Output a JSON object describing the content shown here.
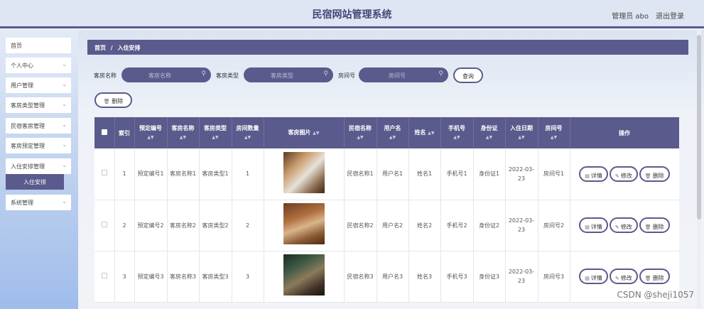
{
  "header": {
    "title": "民宿网站管理系统",
    "user_label": "管理员 abo",
    "logout_label": "退出登录"
  },
  "sidebar": {
    "items": [
      {
        "label": "首页",
        "has_children": false
      },
      {
        "label": "个人中心",
        "has_children": true
      },
      {
        "label": "用户管理",
        "has_children": true
      },
      {
        "label": "客房类型管理",
        "has_children": true
      },
      {
        "label": "民宿客房管理",
        "has_children": true
      },
      {
        "label": "客房预定管理",
        "has_children": true
      },
      {
        "label": "入住安排管理",
        "has_children": true
      },
      {
        "label": "系统管理",
        "has_children": true
      }
    ],
    "active_sub": "入住安排"
  },
  "breadcrumb": {
    "home": "首页",
    "separator": "/",
    "current": "入住安排"
  },
  "search": {
    "fields": [
      {
        "label": "客房名称",
        "placeholder": "客房名称"
      },
      {
        "label": "客房类型",
        "placeholder": "客房类型"
      },
      {
        "label": "房间号",
        "placeholder": "房间号"
      }
    ],
    "button_label": "查询"
  },
  "toolbar": {
    "delete_label": "删除"
  },
  "table": {
    "columns": [
      "索引",
      "预定编号",
      "客房名称",
      "客房类型",
      "房间数量",
      "客房图片",
      "民宿名称",
      "用户名",
      "姓名",
      "手机号",
      "身份证",
      "入住日期",
      "房间号",
      "操作"
    ],
    "rows": [
      {
        "index": "1",
        "booking_no": "预定编号1",
        "room_name": "客房名称1",
        "room_type": "客房类型1",
        "room_count": "1",
        "bnb_name": "民宿名称1",
        "username": "用户名1",
        "name": "姓名1",
        "phone": "手机号1",
        "id_card": "身份证1",
        "checkin_date": "2022-03-23",
        "room_no": "房间号1"
      },
      {
        "index": "2",
        "booking_no": "预定编号2",
        "room_name": "客房名称2",
        "room_type": "客房类型2",
        "room_count": "2",
        "bnb_name": "民宿名称2",
        "username": "用户名2",
        "name": "姓名2",
        "phone": "手机号2",
        "id_card": "身份证2",
        "checkin_date": "2022-03-23",
        "room_no": "房间号2"
      },
      {
        "index": "3",
        "booking_no": "预定编号3",
        "room_name": "客房名称3",
        "room_type": "客房类型3",
        "room_count": "3",
        "bnb_name": "民宿名称3",
        "username": "用户名3",
        "name": "姓名3",
        "phone": "手机号3",
        "id_card": "身份证3",
        "checkin_date": "2022-03-23",
        "room_no": "房间号3"
      }
    ],
    "actions": {
      "detail": "详情",
      "edit": "修改",
      "delete": "删除"
    }
  },
  "watermark": "CSDN @sheji1057",
  "colors": {
    "accent": "#5a5b8c",
    "background": "#e9edf5"
  },
  "icons": {
    "search": "magnifier-icon",
    "expand": "chevron-down-icon",
    "delete": "trash-icon",
    "detail": "document-icon",
    "edit": "pencil-icon"
  }
}
